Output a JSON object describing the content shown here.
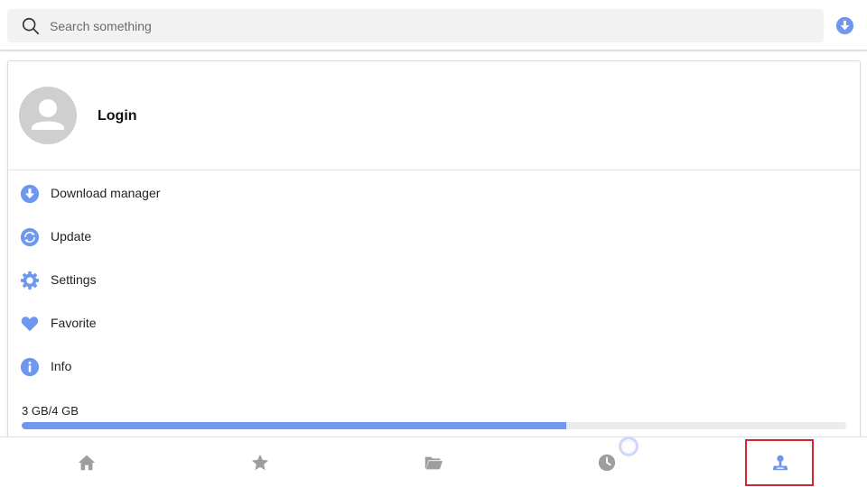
{
  "search": {
    "placeholder": "Search something",
    "search_icon": "search-icon",
    "download_icon": "download-circle-icon"
  },
  "profile": {
    "avatar_icon": "user-avatar-icon",
    "login_label": "Login"
  },
  "menu": {
    "items": [
      {
        "label": "Download manager",
        "icon": "download-circle-icon"
      },
      {
        "label": "Update",
        "icon": "refresh-circle-icon"
      },
      {
        "label": "Settings",
        "icon": "gear-icon"
      },
      {
        "label": "Favorite",
        "icon": "heart-icon"
      },
      {
        "label": "Info",
        "icon": "info-circle-icon"
      }
    ]
  },
  "storage": {
    "label": "3 GB/4 GB",
    "used_fraction": 0.66
  },
  "bottom_nav": {
    "items": [
      {
        "icon": "home-icon",
        "active": false
      },
      {
        "icon": "star-icon",
        "active": false
      },
      {
        "icon": "folder-icon",
        "active": false
      },
      {
        "icon": "clock-icon",
        "active": false
      },
      {
        "icon": "profile-icon",
        "active": true
      }
    ]
  },
  "colors": {
    "accent": "#6f97ee",
    "inactive_icon": "#9e9e9e",
    "highlight_frame": "#d9232d"
  }
}
